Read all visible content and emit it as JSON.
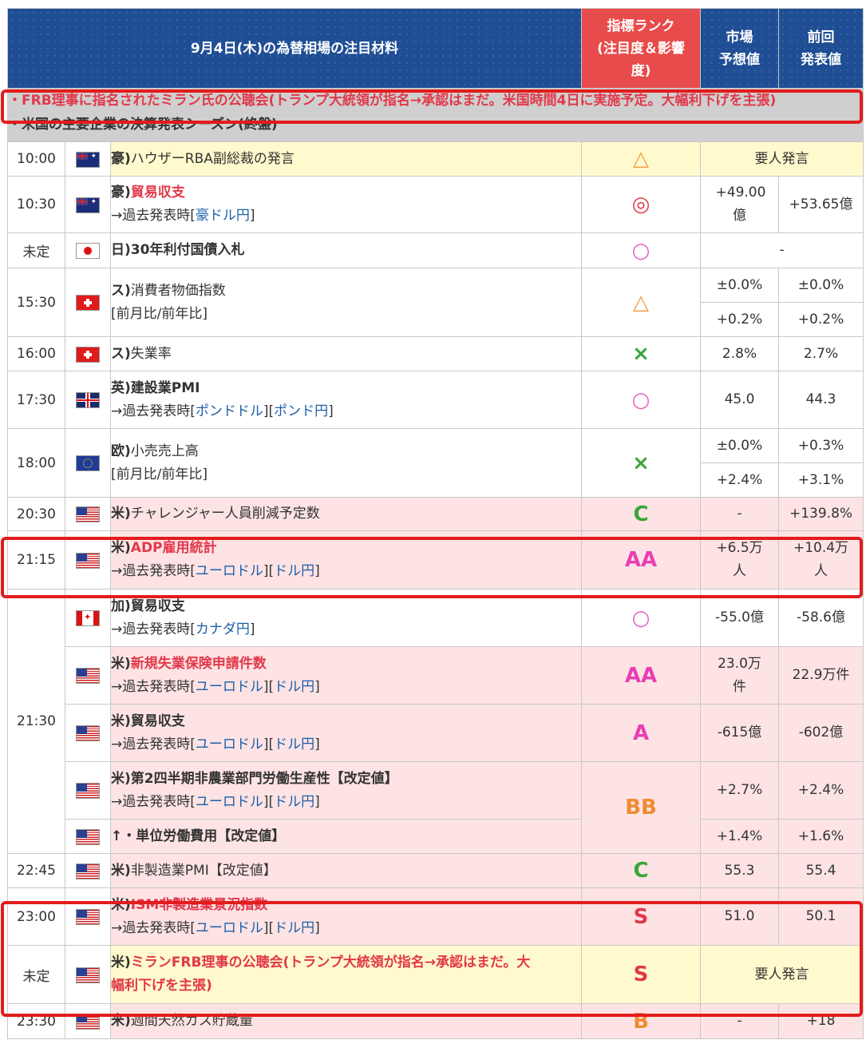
{
  "header": {
    "title": "9月4日(木)の為替相場の注目材料",
    "rank_line1": "指標ランク",
    "rank_line2": "(注目度＆影響",
    "rank_line3": "度)",
    "forecast_line1": "市場",
    "forecast_line2": "予想値",
    "previous_line1": "前回",
    "previous_line2": "発表値"
  },
  "notes": {
    "note1": "・FRB理事に指名されたミラン氏の公聴会(トランプ大統領が指名→承認はまだ。米国時間4日に実施予定。大幅利下げを主張)",
    "note2": "・米国の主要企業の決算発表シーズン(終盤)"
  },
  "rows": [
    {
      "time": "10:00",
      "flag": "au-flag-icon",
      "prefix": "豪)",
      "name": "ハウザーRBA副総裁の発言",
      "rank": "△",
      "merged": "要人発言"
    },
    {
      "time": "10:30",
      "flag": "au-flag-icon",
      "prefix": "豪)",
      "name": "貿易収支",
      "link_prefix": "→過去発表時[",
      "link1": "豪ドル円",
      "link_suffix": "]",
      "rank": "◎",
      "forecast": "+49.00億",
      "previous": "+53.65億"
    },
    {
      "time": "未定",
      "flag": "jp-flag-icon",
      "prefix": "日)",
      "name": "30年利付国債入札",
      "rank": "○",
      "merged": "-"
    },
    {
      "time": "15:30",
      "flag": "ch-flag-icon",
      "prefix": "ス)",
      "name": "消費者物価指数",
      "sub": "[前月比/前年比]",
      "rank": "△",
      "forecast": "±0.0%",
      "previous": "±0.0%",
      "forecast2": "+0.2%",
      "previous2": "+0.2%"
    },
    {
      "time": "16:00",
      "flag": "ch-flag-icon",
      "prefix": "ス)",
      "name": "失業率",
      "rank": "×",
      "forecast": "2.8%",
      "previous": "2.7%"
    },
    {
      "time": "17:30",
      "flag": "gb-flag-icon",
      "prefix": "英)",
      "name": "建設業PMI",
      "link_prefix": "→過去発表時[",
      "link1": "ポンドドル",
      "link_mid": "][",
      "link2": "ポンド円",
      "link_suffix": "]",
      "rank": "○",
      "forecast": "45.0",
      "previous": "44.3"
    },
    {
      "time": "18:00",
      "flag": "eu-flag-icon",
      "prefix": "欧)",
      "name": "小売売上高",
      "sub": "[前月比/前年比]",
      "rank": "×",
      "forecast": "±0.0%",
      "previous": "+0.3%",
      "forecast2": "+2.4%",
      "previous2": "+3.1%"
    },
    {
      "time": "20:30",
      "flag": "us-flag-icon",
      "prefix": "米)",
      "name": "チャレンジャー人員削減予定数",
      "rank": "C",
      "forecast": "-",
      "previous": "+139.8%"
    },
    {
      "time": "21:15",
      "flag": "us-flag-icon",
      "prefix": "米)",
      "name": "ADP雇用統計",
      "link_prefix": "→過去発表時[",
      "link1": "ユーロドル",
      "link_mid": "][",
      "link2": "ドル円",
      "link_suffix": "]",
      "rank": "AA",
      "forecast": "+6.5万人",
      "previous": "+10.4万人"
    },
    {
      "time": "21:30",
      "flag": "ca-flag-icon",
      "prefix": "加)",
      "name": "貿易収支",
      "link_prefix": "→過去発表時[",
      "link1": "カナダ円",
      "link_suffix": "]",
      "rank": "○",
      "forecast": "-55.0億",
      "previous": "-58.6億"
    },
    {
      "flag": "us-flag-icon",
      "prefix": "米)",
      "name": "新規失業保険申請件数",
      "link_prefix": "→過去発表時[",
      "link1": "ユーロドル",
      "link_mid": "][",
      "link2": "ドル円",
      "link_suffix": "]",
      "rank": "AA",
      "forecast": "23.0万件",
      "previous": "22.9万件"
    },
    {
      "flag": "us-flag-icon",
      "prefix": "米)",
      "name": "貿易収支",
      "link_prefix": "→過去発表時[",
      "link1": "ユーロドル",
      "link_mid": "][",
      "link2": "ドル円",
      "link_suffix": "]",
      "rank": "A",
      "forecast": "-615億",
      "previous": "-602億"
    },
    {
      "flag": "us-flag-icon",
      "prefix": "米)",
      "name": "第2四半期非農業部門労働生産性【改定値】",
      "link_prefix": "→過去発表時[",
      "link1": "ユーロドル",
      "link_mid": "][",
      "link2": "ドル円",
      "link_suffix": "]",
      "rank": "BB",
      "forecast": "+2.7%",
      "previous": "+2.4%"
    },
    {
      "flag": "us-flag-icon",
      "prefix": "↑・",
      "name": "単位労働費用【改定値】",
      "forecast": "+1.4%",
      "previous": "+1.6%"
    },
    {
      "time": "22:45",
      "flag": "us-flag-icon",
      "prefix": "米)",
      "name": "非製造業PMI【改定値】",
      "rank": "C",
      "forecast": "55.3",
      "previous": "55.4"
    },
    {
      "time": "23:00",
      "flag": "us-flag-icon",
      "prefix": "米)",
      "name": "ISM非製造業景況指数",
      "link_prefix": "→過去発表時[",
      "link1": "ユーロドル",
      "link_mid": "][",
      "link2": "ドル円",
      "link_suffix": "]",
      "rank": "S",
      "forecast": "51.0",
      "previous": "50.1"
    },
    {
      "time": "未定",
      "flag": "us-flag-icon",
      "prefix": "米)",
      "name_line1": "ミランFRB理事の公聴会(トランプ大統領が指名→承認はまだ。大",
      "name_line2": "幅利下げを主張)",
      "rank": "S",
      "merged": "要人発言"
    },
    {
      "time": "23:30",
      "flag": "us-flag-icon",
      "prefix": "米)",
      "name": "週間天然ガス貯蔵量",
      "rank": "B",
      "forecast": "-",
      "previous": "+18"
    }
  ],
  "colors": {
    "header_blue": "#1f4e95",
    "rank_red": "#e84b4b",
    "highlight": "#e21c1c",
    "row_pink": "#fde3e4",
    "row_yellow": "#fffacd"
  }
}
